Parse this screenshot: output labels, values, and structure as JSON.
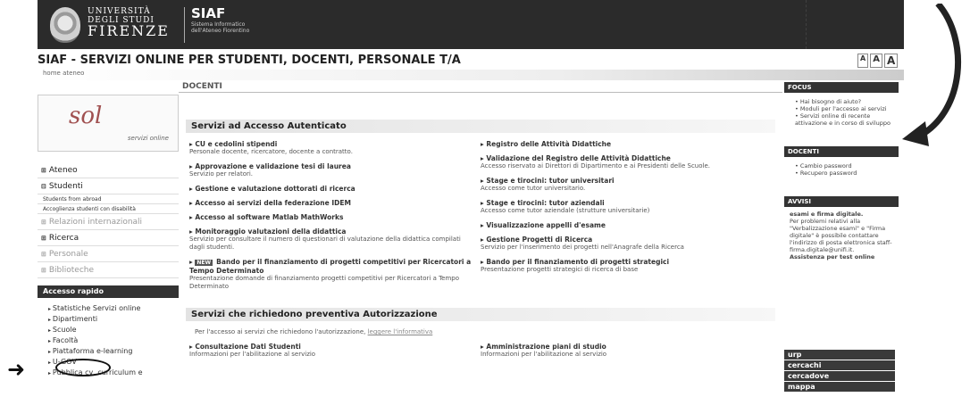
{
  "header": {
    "uni_line1": "UNIVERSITÀ",
    "uni_line2": "DEGLI STUDI",
    "uni_line3": "FIRENZE",
    "brand": "SIAF",
    "brand_sub1": "Sistema Informatico",
    "brand_sub2": "dell'Ateneo Fiorentino"
  },
  "page_title": "SIAF - SERVIZI ONLINE PER STUDENTI, DOCENTI, PERSONALE T/A",
  "font_controls": [
    "A",
    "A",
    "A"
  ],
  "breadcrumb": "home ateneo",
  "logo": {
    "mark": "sol",
    "tagline": "servizi online"
  },
  "sidebar": {
    "items": [
      {
        "label": "Ateneo"
      },
      {
        "label": "Studenti"
      },
      {
        "sub1": "Students from abroad"
      },
      {
        "sub2": "Accoglienza studenti con disabilità"
      },
      {
        "label": "Relazioni internazionali"
      },
      {
        "label": "Ricerca"
      },
      {
        "label": "Personale"
      },
      {
        "label": "Biblioteche"
      }
    ],
    "quick_title": "Accesso rapido",
    "quick": [
      "Statistiche Servizi online",
      "Dipartimenti",
      "Scuole",
      "Facoltà",
      "Piattaforma e-learning",
      "U-GOV",
      "Pubblica cv, curriculum e"
    ]
  },
  "main": {
    "heading": "DOCENTI",
    "section1": "Servizi ad Accesso Autenticato",
    "left_services": [
      {
        "t": "CU e cedolini stipendi",
        "d": "Personale docente, ricercatore, docente a contratto."
      },
      {
        "t": "Approvazione e validazione tesi di laurea",
        "d": "Servizio per relatori."
      },
      {
        "t": "Gestione e valutazione dottorati di ricerca",
        "d": ""
      },
      {
        "t": "Accesso ai servizi della federazione IDEM",
        "d": ""
      },
      {
        "t": "Accesso al software Matlab MathWorks",
        "d": ""
      },
      {
        "t": "Monitoraggio valutazioni della didattica",
        "d": "Servizio per consultare il numero di questionari di valutazione della didattica compilati dagli studenti."
      },
      {
        "t": "Bando per il finanziamento di progetti competitivi per Ricercatori a Tempo Determinato",
        "d": "Presentazione domande di finanziamento progetti competitivi per Ricercatori a Tempo Determinato",
        "new": "NEW"
      }
    ],
    "right_services": [
      {
        "t": "Registro delle Attività Didattiche",
        "d": ""
      },
      {
        "t": "Validazione del Registro delle Attività Didattiche",
        "d": "Accesso riservato ai Direttori di Dipartimento e ai Presidenti delle Scuole."
      },
      {
        "t": "Stage e tirocini: tutor universitari",
        "d": "Accesso come tutor universitario."
      },
      {
        "t": "Stage e tirocini: tutor aziendali",
        "d": "Accesso come tutor aziendale (strutture universitarie)"
      },
      {
        "t": "Visualizzazione appelli d'esame",
        "d": ""
      },
      {
        "t": "Gestione Progetti di Ricerca",
        "d": "Servizio per l'inserimento dei progetti nell'Anagrafe della Ricerca"
      },
      {
        "t": "Bando per il finanziamento di progetti strategici",
        "d": "Presentazione progetti strategici di ricerca di base"
      }
    ],
    "section2": "Servizi che richiedono preventiva Autorizzazione",
    "note_text": "Per l'accesso ai servizi che richiedono l'autorizzazione,",
    "note_link": "leggere l'informativa",
    "left_services2": [
      {
        "t": "Consultazione Dati Studenti",
        "d": "Informazioni per l'abilitazione al servizio"
      }
    ],
    "right_services2": [
      {
        "t": "Amministrazione piani di studio",
        "d": "Informazioni per l'abilitazione al servizio"
      }
    ]
  },
  "right": {
    "focus": "FOCUS",
    "focus_items": [
      "Hai bisogno di aiuto?",
      "Moduli per l'accesso ai servizi",
      "Servizi online di recente attivazione e in corso di sviluppo"
    ],
    "docenti": "DOCENTI",
    "docenti_items": [
      "Cambio password",
      "Recupero password"
    ],
    "avviso": "AVVISI",
    "avviso_bold": "esami e firma digitale.",
    "avviso_text": "Per problemi relativi alla \"Verbalizzazione esami\" e \"Firma digitale\" è possibile contattare l'indirizzo di posta elettronica staff-firma.digitale@unifi.it.",
    "avviso_bold2": "Assistenza per test online",
    "links": [
      "urp",
      "cercachi",
      "cercadove",
      "mappa"
    ]
  }
}
